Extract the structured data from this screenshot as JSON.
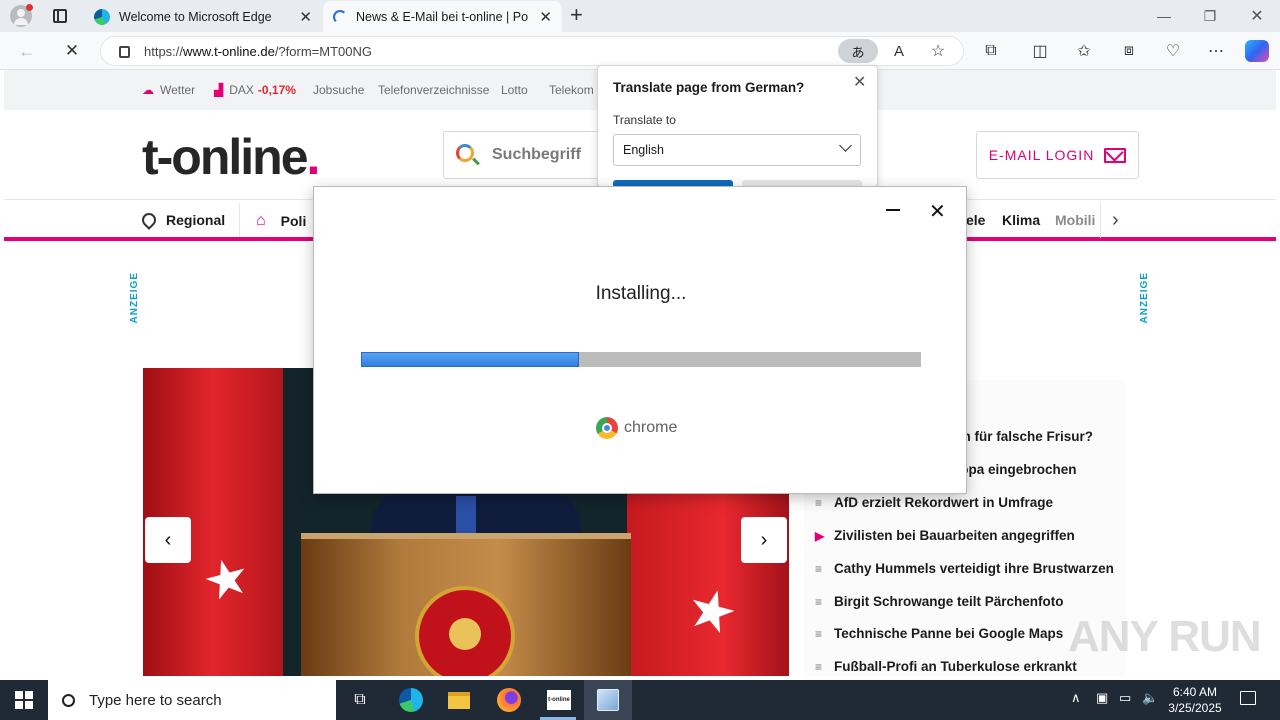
{
  "browser": {
    "tabs": [
      {
        "label": "Welcome to Microsoft Edge"
      },
      {
        "label": "News & E-Mail bei t-online | Polit"
      }
    ],
    "url_prefix": "https://",
    "url_host": "www.t-online.de",
    "url_path": "/?form=MT00NG"
  },
  "site": {
    "top_links": [
      "Wetter",
      "DAX",
      "-0,17%",
      "Jobsuche",
      "Telefonverzeichnisse",
      "Lotto",
      "Telekom"
    ],
    "logo_text": "t-online",
    "logo_dot": ".",
    "search_placeholder": "Suchbegriff",
    "mail_login": "E-MAIL LOGIN",
    "nav": [
      "Regional",
      "Poli",
      "ele",
      "Klima",
      "Mobili"
    ],
    "anzeige": "ANZEIGE",
    "news": [
      "en für falsche Frisur?",
      "ropa eingebrochen",
      "AfD erzielt Rekordwert in Umfrage",
      "Zivilisten bei Bauarbeiten angegriffen",
      "Cathy Hummels verteidigt ihre Brustwarzen",
      "Birgit Schrowange teilt Pärchenfoto",
      "Technische Panne bei Google Maps",
      "Fußball-Profi an Tuberkulose erkrankt"
    ]
  },
  "translate": {
    "title": "Translate page from German?",
    "translate_to_label": "Translate to",
    "selected_language": "English"
  },
  "installer": {
    "status": "Installing...",
    "progress": 0.39,
    "brand": "chrome"
  },
  "taskbar": {
    "search_placeholder": "Type here to search",
    "time": "6:40 AM",
    "date": "3/25/2025"
  },
  "watermark": "ANY RUN",
  "colors": {
    "accent": "#e20074",
    "progress": "#2f7fe0",
    "anzeige": "#0e9fc7"
  }
}
